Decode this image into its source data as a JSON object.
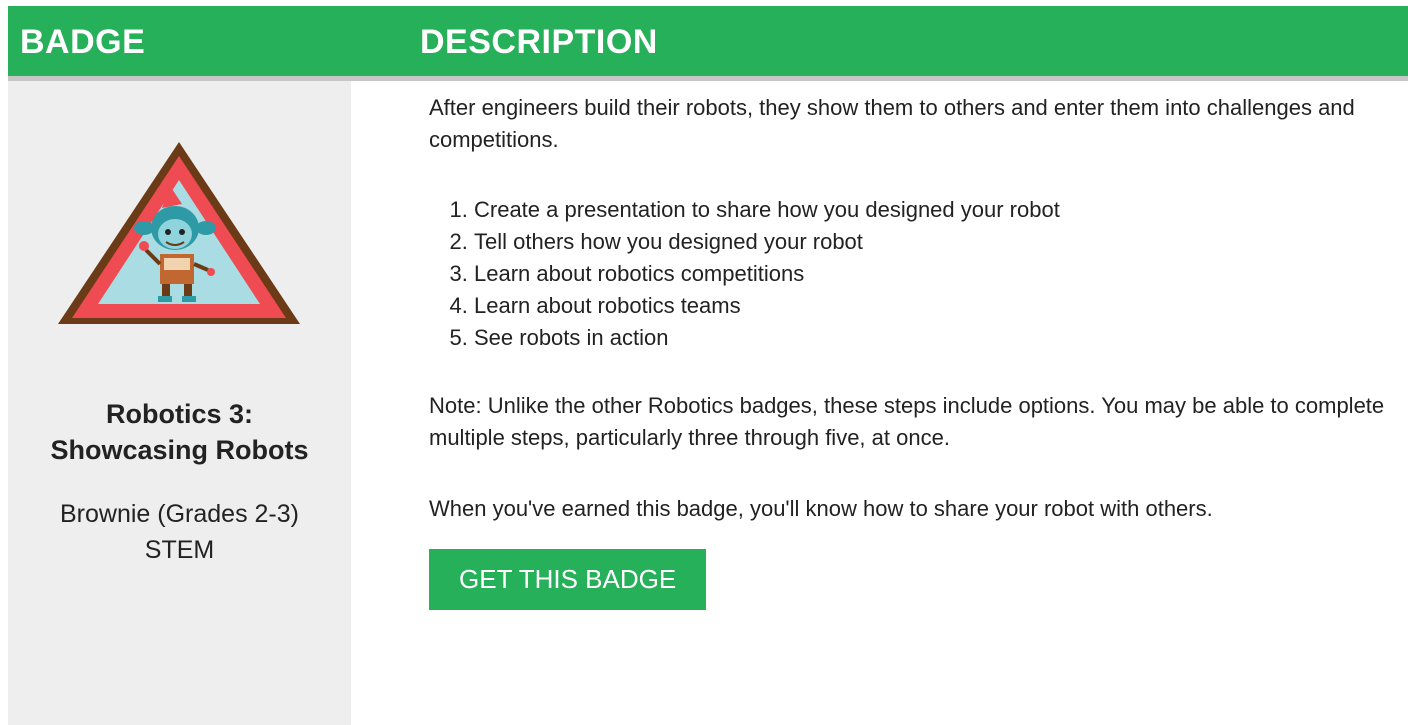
{
  "header": {
    "badge_label": "BADGE",
    "description_label": "DESCRIPTION"
  },
  "badge": {
    "image_icon": "brownie-robot-triangle-badge-icon",
    "name_line1": "Robotics 3:",
    "name_line2": "Showcasing Robots",
    "level": "Brownie (Grades 2-3)",
    "category": "STEM"
  },
  "description": {
    "intro": "After engineers build their robots, they show them to others and enter them into challenges and competitions.",
    "steps": [
      "Create a presentation to share how you designed your robot",
      "Tell others how you designed your robot",
      "Learn about robotics competitions",
      "Learn about robotics teams",
      "See robots in action"
    ],
    "note": "Note: Unlike the other Robotics badges, these steps include options. You may be able to complete multiple steps, particularly three through five, at once.",
    "earned": "When you've earned this badge, you'll know how to share your robot with others."
  },
  "cta": {
    "label": "GET THIS BADGE"
  },
  "colors": {
    "brand_green": "#26b05a",
    "panel_gray": "#eeeeee",
    "badge_brown": "#6b3a17",
    "badge_red": "#ee4b53",
    "badge_sky": "#a9dde3"
  }
}
